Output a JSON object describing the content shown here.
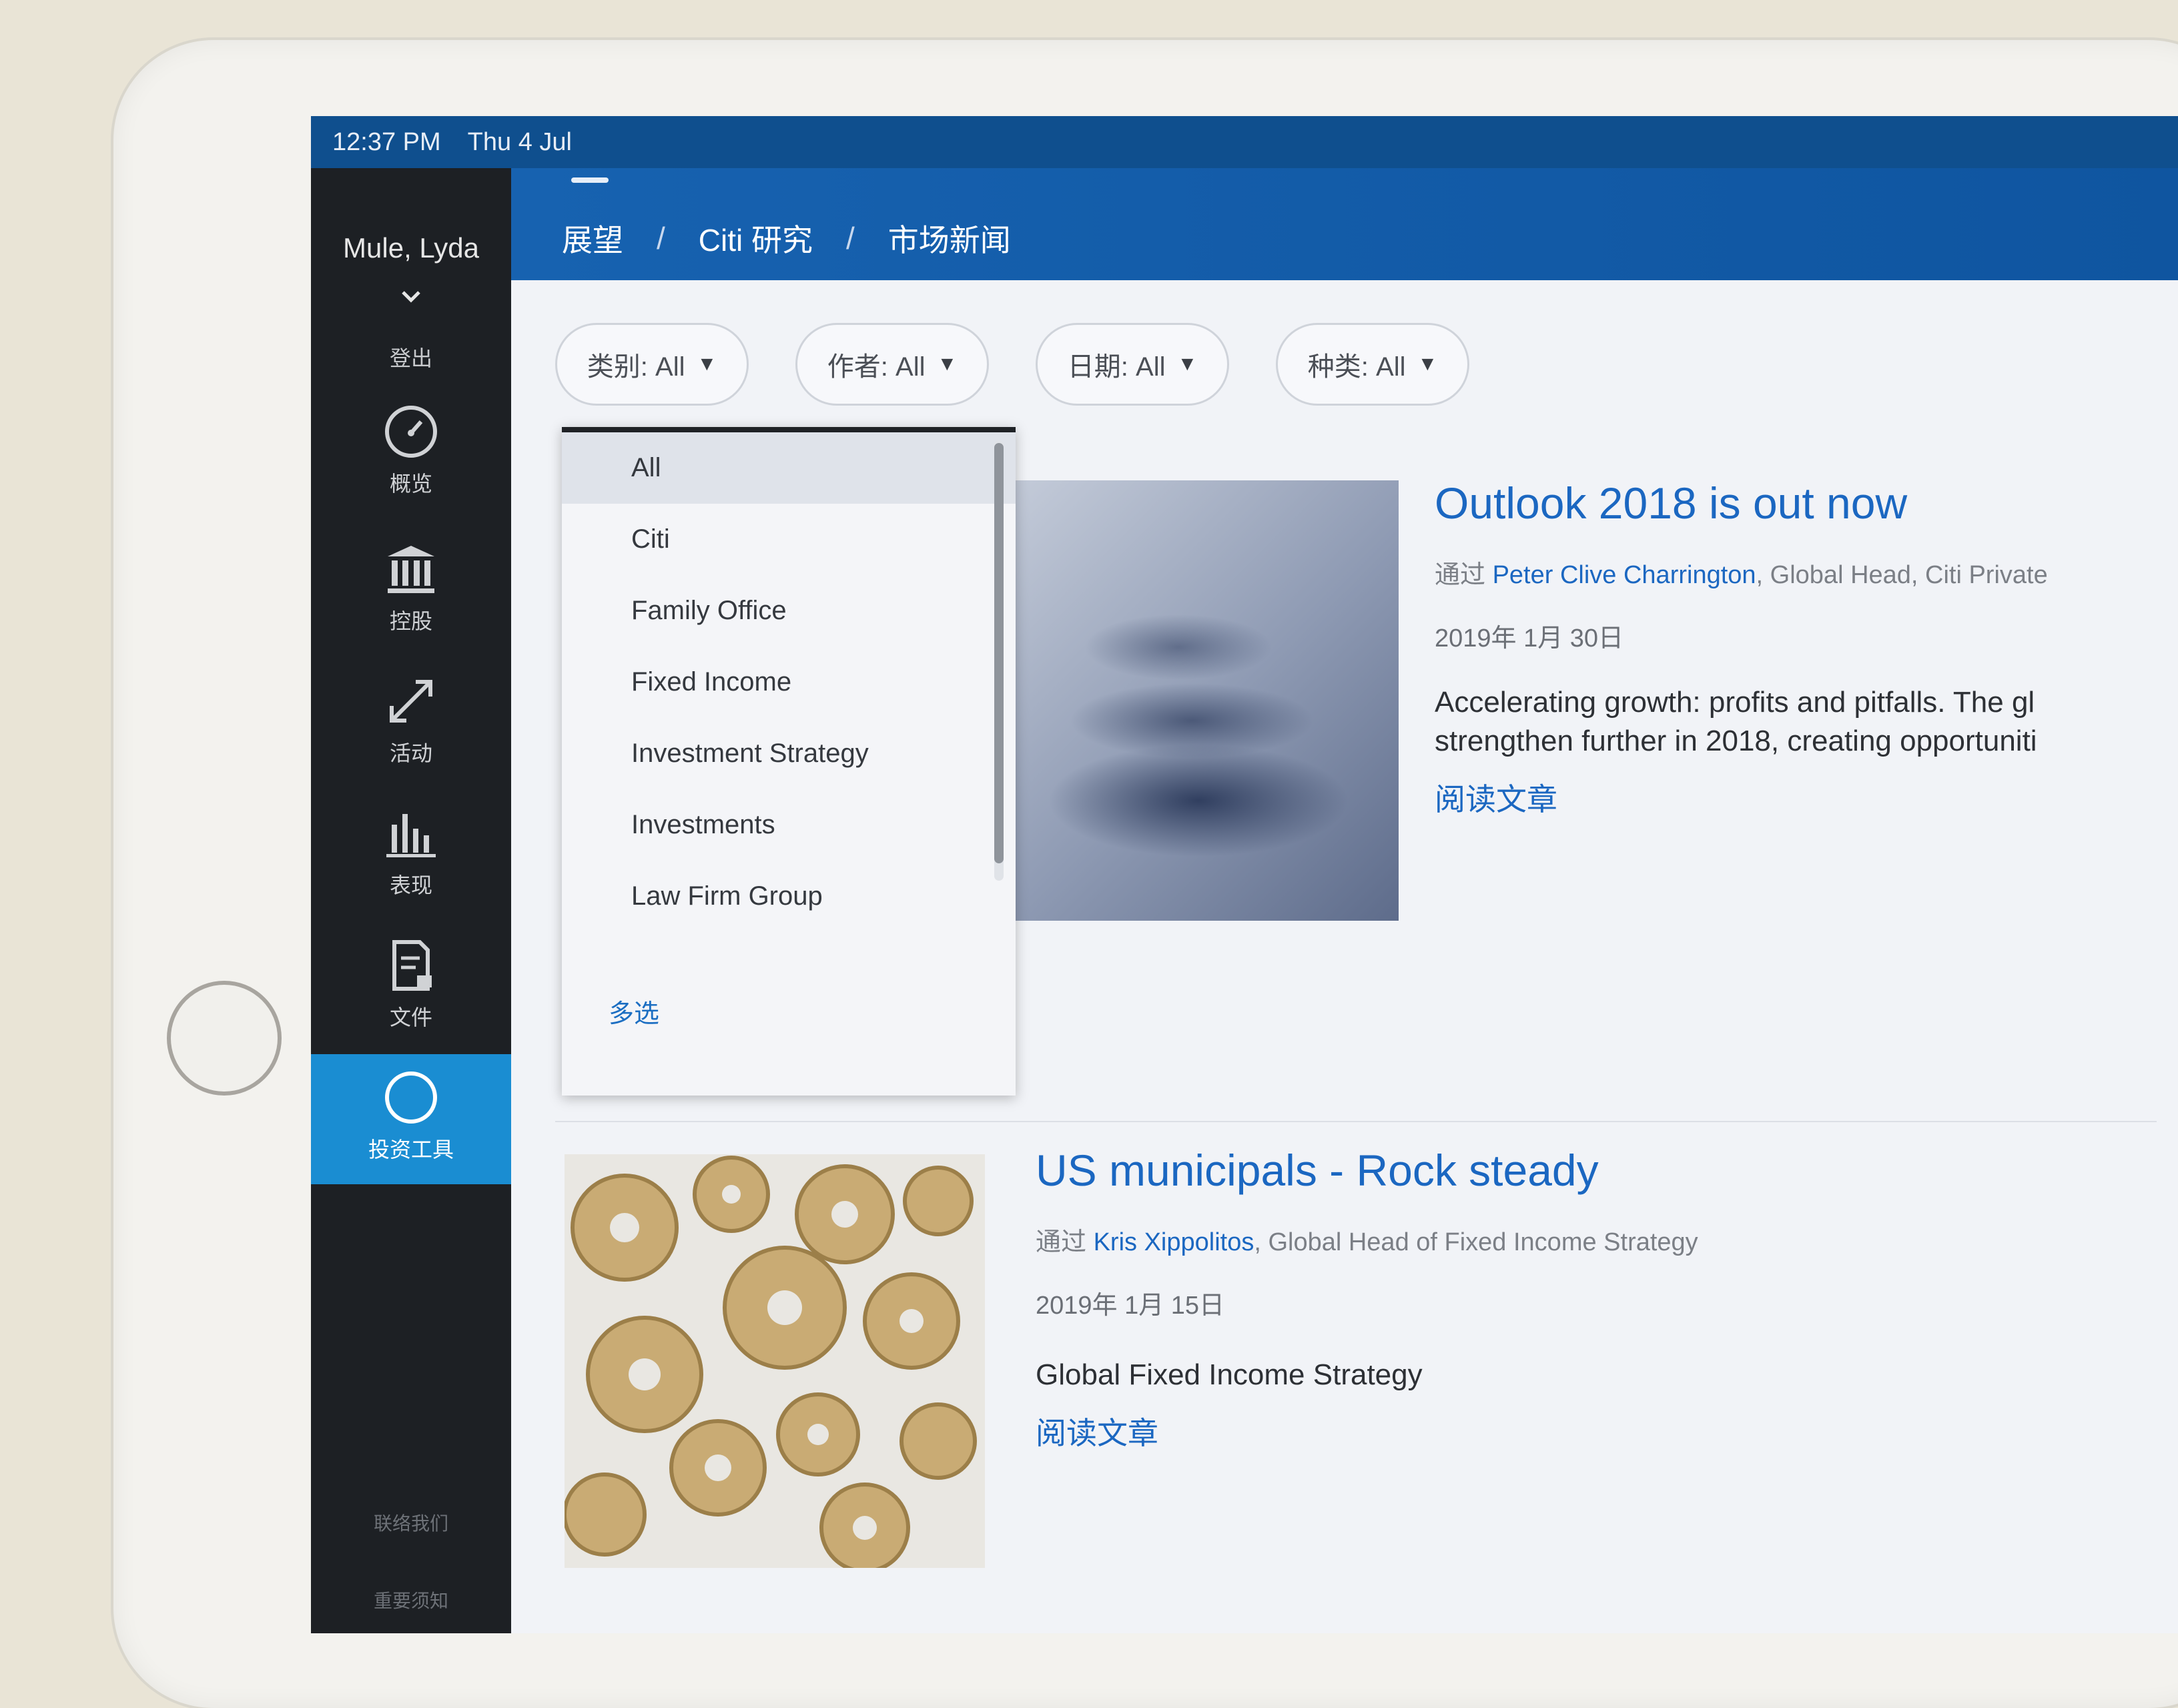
{
  "status_bar": {
    "time": "12:37 PM",
    "date": "Thu 4 Jul"
  },
  "breadcrumb": [
    "展望",
    "Citi 研究",
    "市场新闻"
  ],
  "breadcrumb_separator": "/",
  "sidebar": {
    "user_name": "Mule, Lyda",
    "logout_label": "登出",
    "items": [
      {
        "label": "概览",
        "icon": "speedometer-icon"
      },
      {
        "label": "控股",
        "icon": "bank-icon"
      },
      {
        "label": "活动",
        "icon": "arrows-expand-icon"
      },
      {
        "label": "表现",
        "icon": "bar-chart-icon"
      },
      {
        "label": "文件",
        "icon": "document-lock-icon"
      },
      {
        "label": "投资工具",
        "icon": "compass-icon",
        "active": true
      }
    ],
    "footer": [
      "联络我们",
      "重要须知"
    ]
  },
  "filters": [
    {
      "label": "类别: All"
    },
    {
      "label": "作者: All"
    },
    {
      "label": "日期: All"
    },
    {
      "label": "种类: All"
    }
  ],
  "category_dropdown": {
    "options": [
      "All",
      "Citi",
      "Family Office",
      "Fixed Income",
      "Investment Strategy",
      "Investments",
      "Law Firm Group"
    ],
    "selected": "All",
    "multi_select_label": "多选"
  },
  "articles": [
    {
      "title": "Outlook 2018 is out now",
      "by_prefix": "通过",
      "author": "Peter Clive Charrington",
      "author_role": ", Global Head, Citi Private",
      "date": "2019年 1月 30日",
      "description_line1": "Accelerating growth: profits and pitfalls. The gl",
      "description_line2": "strengthen further in 2018, creating opportuniti",
      "read_label": "阅读文章"
    },
    {
      "title": "US municipals - Rock steady",
      "by_prefix": "通过",
      "author": "Kris Xippolitos",
      "author_role": ", Global Head of Fixed Income Strategy",
      "date": "2019年 1月 15日",
      "description_line1": "Global Fixed Income Strategy",
      "read_label": "阅读文章"
    }
  ],
  "colors": {
    "header_blue": "#1762b0",
    "sidebar_dark": "#1d2024",
    "active_nav": "#1a8dd2",
    "link_blue": "#1b67c1"
  }
}
